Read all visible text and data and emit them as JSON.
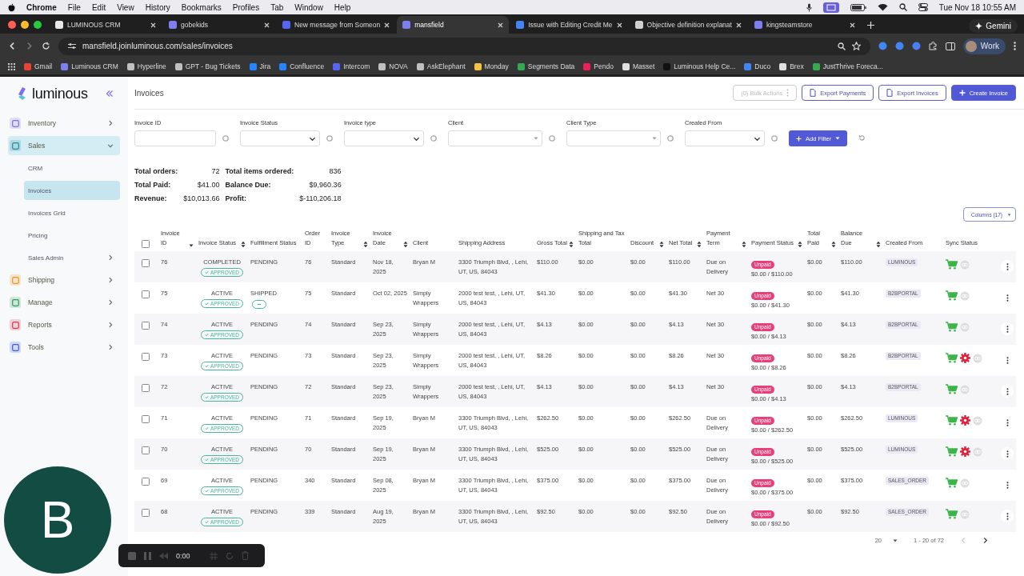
{
  "menubar": {
    "app": "Chrome",
    "menus": [
      "File",
      "Edit",
      "View",
      "History",
      "Bookmarks",
      "Profiles",
      "Tab",
      "Window",
      "Help"
    ],
    "time": "Tue Nov 18  10:55 AM"
  },
  "browser_tabs": [
    {
      "title": "LUMINOUS CRM",
      "selected": false,
      "color": "#e8e8e8"
    },
    {
      "title": "gobekids",
      "selected": false,
      "color": "#7b7ff0"
    },
    {
      "title": "New message from Someon",
      "selected": false,
      "color": "#5865f2"
    },
    {
      "title": "mansfield",
      "selected": true,
      "color": "#7b7ff0"
    },
    {
      "title": "Issue with Editing Credit Me",
      "selected": false,
      "color": "#4285f4"
    },
    {
      "title": "Objective definition explanat",
      "selected": false,
      "color": "#d0d0d0"
    },
    {
      "title": "kingsteamstore",
      "selected": false,
      "color": "#7b7ff0"
    }
  ],
  "gemini_button": "Gemini",
  "address": "mansfield.joinluminous.com/sales/invoices",
  "profile": "Work",
  "bookmarks": [
    {
      "label": "Gmail",
      "color": "#ea4335"
    },
    {
      "label": "Luminous CRM",
      "color": "#7b7ff0"
    },
    {
      "label": "Hyperline",
      "color": "#c0c0c0"
    },
    {
      "label": "GPT - Bug Tickets",
      "color": "#c0c0c0"
    },
    {
      "label": "Jira",
      "color": "#2684ff"
    },
    {
      "label": "Confluence",
      "color": "#2684ff"
    },
    {
      "label": "Intercom",
      "color": "#5865f2"
    },
    {
      "label": "NOVA",
      "color": "#c0c0c0"
    },
    {
      "label": "AskElephant",
      "color": "#c0c0c0"
    },
    {
      "label": "Monday",
      "color": "#f6c343"
    },
    {
      "label": "Segments Data",
      "color": "#34a853"
    },
    {
      "label": "Pendo",
      "color": "#ec2059"
    },
    {
      "label": "Masset",
      "color": "#e0e0e0"
    },
    {
      "label": "Luminous Help Ce...",
      "color": "#111111"
    },
    {
      "label": "Duco",
      "color": "#4285f4"
    },
    {
      "label": "Brex",
      "color": "#e0e0e0"
    },
    {
      "label": "JustThrive Foreca...",
      "color": "#34a853"
    }
  ],
  "sidebar": {
    "logo": "luminous",
    "items": [
      {
        "label": "Inventory",
        "color": "#7c6fd6",
        "expanded": false,
        "selected": false
      },
      {
        "label": "Sales",
        "color": "#1f8a9a",
        "expanded": true,
        "selected": true,
        "children": [
          {
            "label": "CRM",
            "selected": false,
            "has_submenu": false
          },
          {
            "label": "Invoices",
            "selected": true,
            "has_submenu": false
          },
          {
            "label": "Invoices Grid",
            "selected": false,
            "has_submenu": false
          },
          {
            "label": "Pricing",
            "selected": false,
            "has_submenu": false
          },
          {
            "label": "Sales Admin",
            "selected": false,
            "has_submenu": true
          }
        ]
      },
      {
        "label": "Shipping",
        "color": "#e8961e",
        "expanded": false,
        "selected": false
      },
      {
        "label": "Manage",
        "color": "#2e9a5a",
        "expanded": false,
        "selected": false
      },
      {
        "label": "Reports",
        "color": "#d8344f",
        "expanded": false,
        "selected": false
      },
      {
        "label": "Tools",
        "color": "#3b5bdb",
        "expanded": false,
        "selected": false
      }
    ]
  },
  "page_title": "Invoices",
  "actions": [
    {
      "label": "(0) Bulk Actions",
      "kind": "bulk",
      "disabled": true
    },
    {
      "label": "Export Payments",
      "kind": "export",
      "disabled": false
    },
    {
      "label": "Export Invoices",
      "kind": "export",
      "disabled": false
    },
    {
      "label": "Create Invoice",
      "kind": "create",
      "disabled": false
    }
  ],
  "filters": [
    {
      "label": "Invoice ID",
      "kind": "input"
    },
    {
      "label": "Invoice Status",
      "kind": "select"
    },
    {
      "label": "Invoice type",
      "kind": "select"
    },
    {
      "label": "Client",
      "kind": "combo"
    },
    {
      "label": "Client Type",
      "kind": "combo"
    },
    {
      "label": "Created From",
      "kind": "select"
    }
  ],
  "add_filter": "Add Filter",
  "stats": [
    {
      "label": "Total orders:",
      "value": "72"
    },
    {
      "label": "Total items ordered:",
      "value": "836"
    },
    {
      "label": "Total Paid:",
      "value": "$41.00"
    },
    {
      "label": "Balance Due:",
      "value": "$9,960.36"
    },
    {
      "label": "Revenue:",
      "value": "$10,013.66"
    },
    {
      "label": "Profit:",
      "value": "$-110,206.18"
    }
  ],
  "columns_button": "Columns (17)",
  "table": {
    "all_checked": false,
    "columns": [
      {
        "label": "Invoice ID",
        "sortable": true,
        "sorted": true
      },
      {
        "label": "Invoice Status",
        "sortable": true,
        "sorted": false
      },
      {
        "label": "Fulfillment Status",
        "sortable": false
      },
      {
        "label": "Order ID",
        "sortable": false
      },
      {
        "label": "Invoice Type",
        "sortable": true,
        "sorted": false
      },
      {
        "label": "Invoice Date",
        "sortable": true,
        "sorted": false
      },
      {
        "label": "Client",
        "sortable": false
      },
      {
        "label": "Shipping Address",
        "sortable": false
      },
      {
        "label": "Gross Total",
        "sortable": true,
        "sorted": false
      },
      {
        "label": "Shipping and Tax Total",
        "sortable": false
      },
      {
        "label": "Discount",
        "sortable": true,
        "sorted": false
      },
      {
        "label": "Net Total",
        "sortable": true,
        "sorted": false
      },
      {
        "label": "Payment Term",
        "sortable": true,
        "sorted": false
      },
      {
        "label": "Payment Status",
        "sortable": true,
        "sorted": false
      },
      {
        "label": "Total Paid",
        "sortable": true,
        "sorted": false
      },
      {
        "label": "Balance Due",
        "sortable": true,
        "sorted": false
      },
      {
        "label": "Created From",
        "sortable": false
      },
      {
        "label": "Sync Status",
        "sortable": false
      }
    ],
    "rows": [
      {
        "checked": false,
        "id": "76",
        "status": "COMPLETED",
        "approval": "APPROVED",
        "fulfillment": "PENDING",
        "tracking_badge": false,
        "order_id": "76",
        "type": "Standard",
        "date": "Nov 18, 2025",
        "client": "Bryan M",
        "address": "3300 Triumph Blvd, , Lehi, UT, US, 84043",
        "gross": "$110.00",
        "shipping_tax": "$0.00",
        "discount": "$0.00",
        "net": "$110.00",
        "term": "Due on Delivery",
        "payment_status": "Unpaid",
        "payment_detail": "$0.00 / $110.00",
        "total_paid": "$0.00",
        "balance": "$110.00",
        "created_from": "LUMINOUS",
        "sync_error": false
      },
      {
        "checked": false,
        "id": "75",
        "status": "ACTIVE",
        "approval": "APPROVED",
        "fulfillment": "SHIPPED",
        "tracking_badge": true,
        "order_id": "75",
        "type": "Standard",
        "date": "Oct 02, 2025",
        "client": "Simply Wrappers",
        "address": "2000 test test, , Lehi, UT, US, 84043",
        "gross": "$41.30",
        "shipping_tax": "$0.00",
        "discount": "$0.00",
        "net": "$41.30",
        "term": "Net 30",
        "payment_status": "Unpaid",
        "payment_detail": "$0.00 / $41.30",
        "total_paid": "$0.00",
        "balance": "$41.30",
        "created_from": "B2BPORTAL",
        "sync_error": false
      },
      {
        "checked": false,
        "id": "74",
        "status": "ACTIVE",
        "approval": "APPROVED",
        "fulfillment": "PENDING",
        "tracking_badge": false,
        "order_id": "74",
        "type": "Standard",
        "date": "Sep 23, 2025",
        "client": "Simply Wrappers",
        "address": "2000 test test, , Lehi, UT, US, 84043",
        "gross": "$4.13",
        "shipping_tax": "$0.00",
        "discount": "$0.00",
        "net": "$4.13",
        "term": "Net 30",
        "payment_status": "Unpaid",
        "payment_detail": "$0.00 / $4.13",
        "total_paid": "$0.00",
        "balance": "$4.13",
        "created_from": "B2BPORTAL",
        "sync_error": false
      },
      {
        "checked": false,
        "id": "73",
        "status": "ACTIVE",
        "approval": "APPROVED",
        "fulfillment": "PENDING",
        "tracking_badge": false,
        "order_id": "73",
        "type": "Standard",
        "date": "Sep 23, 2025",
        "client": "Simply Wrappers",
        "address": "2000 test test, , Lehi, UT, US, 84043",
        "gross": "$8.26",
        "shipping_tax": "$0.00",
        "discount": "$0.00",
        "net": "$8.26",
        "term": "Net 30",
        "payment_status": "Unpaid",
        "payment_detail": "$0.00 / $8.26",
        "total_paid": "$0.00",
        "balance": "$8.26",
        "created_from": "B2BPORTAL",
        "sync_error": true
      },
      {
        "checked": false,
        "id": "72",
        "status": "ACTIVE",
        "approval": "APPROVED",
        "fulfillment": "PENDING",
        "tracking_badge": false,
        "order_id": "72",
        "type": "Standard",
        "date": "Sep 23, 2025",
        "client": "Simply Wrappers",
        "address": "2000 test test, , Lehi, UT, US, 84043",
        "gross": "$4.13",
        "shipping_tax": "$0.00",
        "discount": "$0.00",
        "net": "$4.13",
        "term": "Net 30",
        "payment_status": "Unpaid",
        "payment_detail": "$0.00 / $4.13",
        "total_paid": "$0.00",
        "balance": "$4.13",
        "created_from": "B2BPORTAL",
        "sync_error": false
      },
      {
        "checked": false,
        "id": "71",
        "status": "ACTIVE",
        "approval": "APPROVED",
        "fulfillment": "PENDING",
        "tracking_badge": false,
        "order_id": "71",
        "type": "Standard",
        "date": "Sep 19, 2025",
        "client": "Bryan M",
        "address": "3300 Triumph Blvd, , Lehi, UT, US, 84043",
        "gross": "$262.50",
        "shipping_tax": "$0.00",
        "discount": "$0.00",
        "net": "$262.50",
        "term": "Due on Delivery",
        "payment_status": "Unpaid",
        "payment_detail": "$0.00 / $262.50",
        "total_paid": "$0.00",
        "balance": "$262.50",
        "created_from": "LUMINOUS",
        "sync_error": true
      },
      {
        "checked": false,
        "id": "70",
        "status": "ACTIVE",
        "approval": "APPROVED",
        "fulfillment": "PENDING",
        "tracking_badge": false,
        "order_id": "70",
        "type": "Standard",
        "date": "Sep 19, 2025",
        "client": "Bryan M",
        "address": "3300 Triumph Blvd, , Lehi, UT, US, 84043",
        "gross": "$525.00",
        "shipping_tax": "$0.00",
        "discount": "$0.00",
        "net": "$525.00",
        "term": "Due on Delivery",
        "payment_status": "Unpaid",
        "payment_detail": "$0.00 / $525.00",
        "total_paid": "$0.00",
        "balance": "$525.00",
        "created_from": "LUMINOUS",
        "sync_error": true
      },
      {
        "checked": false,
        "id": "69",
        "status": "ACTIVE",
        "approval": "APPROVED",
        "fulfillment": "PENDING",
        "tracking_badge": false,
        "order_id": "340",
        "type": "Standard",
        "date": "Sep 08, 2025",
        "client": "Bryan M",
        "address": "3300 Triumph Blvd, , Lehi, UT, US, 84043",
        "gross": "$375.00",
        "shipping_tax": "$0.00",
        "discount": "$0.00",
        "net": "$375.00",
        "term": "Due on Delivery",
        "payment_status": "Unpaid",
        "payment_detail": "$0.00 / $375.00",
        "total_paid": "$0.00",
        "balance": "$375.00",
        "created_from": "SALES_ORDER",
        "sync_error": false
      },
      {
        "checked": false,
        "id": "68",
        "status": "ACTIVE",
        "approval": "APPROVED",
        "fulfillment": "PENDING",
        "tracking_badge": false,
        "order_id": "339",
        "type": "Standard",
        "date": "Aug 19, 2025",
        "client": "Bryan M",
        "address": "3300 Triumph Blvd, , Lehi, UT, US, 84043",
        "gross": "$92.50",
        "shipping_tax": "$0.00",
        "discount": "$0.00",
        "net": "$92.50",
        "term": "Due on Delivery",
        "payment_status": "Unpaid",
        "payment_detail": "$0.00 / $92.50",
        "total_paid": "$0.00",
        "balance": "$92.50",
        "created_from": "SALES_ORDER",
        "sync_error": false
      }
    ]
  },
  "pagination": {
    "page_size": "20",
    "range": "1 - 20 of 72"
  },
  "avatar": {
    "letter": "B"
  },
  "recorder": {
    "time": "0:00"
  }
}
